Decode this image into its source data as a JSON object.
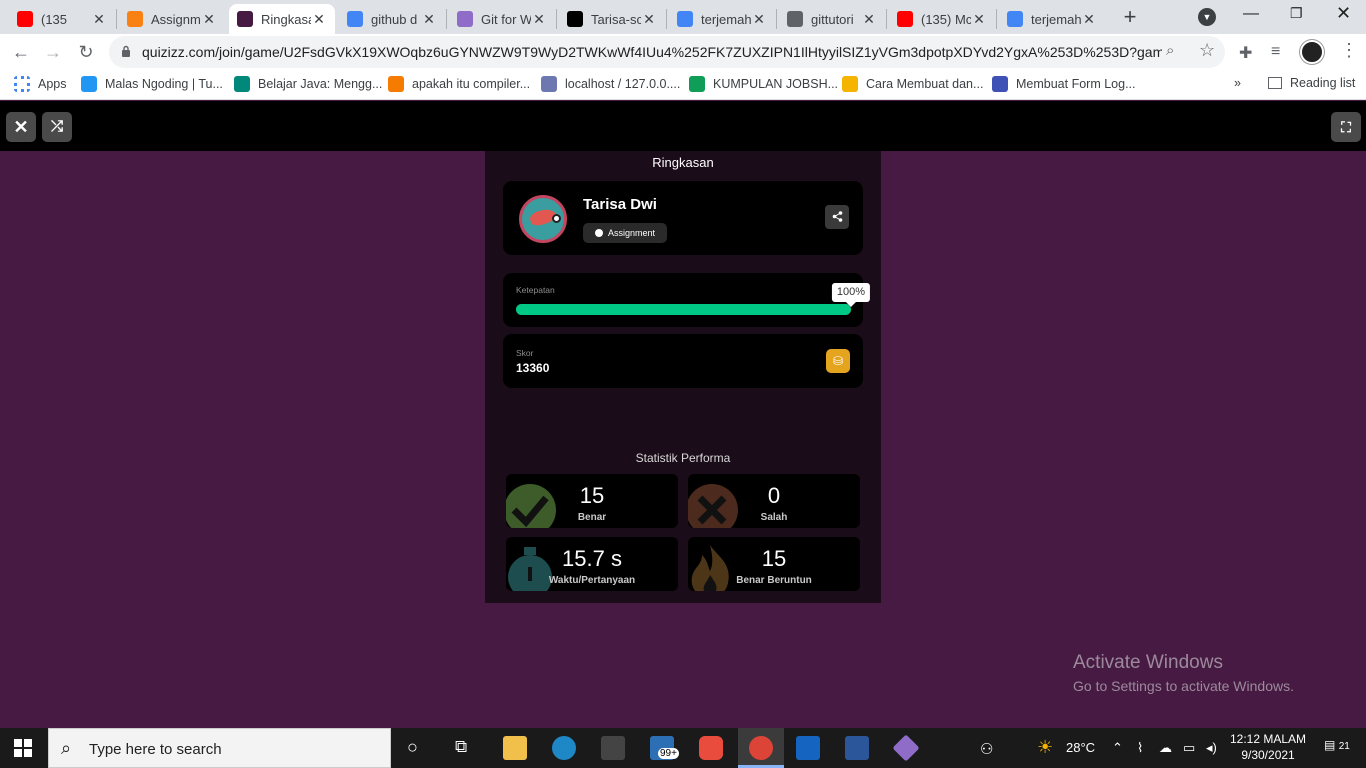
{
  "browser": {
    "tabs": [
      {
        "title": "(135",
        "icon": "youtube-icon",
        "color": "#ff0000"
      },
      {
        "title": "Assignm",
        "icon": "moodle-icon",
        "color": "#f98012"
      },
      {
        "title": "Ringkasa",
        "icon": "quizizz-icon",
        "color": "#461a42"
      },
      {
        "title": "github d",
        "icon": "google-icon",
        "color": "#4285f4"
      },
      {
        "title": "Git for W",
        "icon": "git-icon",
        "color": "#8e6cc7"
      },
      {
        "title": "Tarisa-sc",
        "icon": "github-icon",
        "color": "#000000"
      },
      {
        "title": "terjemah",
        "icon": "google-icon",
        "color": "#4285f4"
      },
      {
        "title": "gittutori",
        "icon": "globe-icon",
        "color": "#5f6368"
      },
      {
        "title": "(135) Mc",
        "icon": "youtube-icon",
        "color": "#ff0000"
      },
      {
        "title": "terjemah",
        "icon": "google-icon",
        "color": "#4285f4"
      }
    ],
    "url": "quizizz.com/join/game/U2FsdGVkX19XWOqbz6uGYNWZW9T9WyD2TWKwWf4IUu4%252FK7ZUXZIPN1IlHtyyilSIZ1yVGm3dpotpXDYvd2YgxA%253D%253D?gameT..."
  },
  "bookmarks": {
    "items": [
      {
        "label": "Apps",
        "color": "#4285f4"
      },
      {
        "label": "Malas Ngoding | Tu...",
        "color": "#2196f3"
      },
      {
        "label": "Belajar Java: Mengg...",
        "color": "#00897b"
      },
      {
        "label": "apakah itu compiler...",
        "color": "#f57c00"
      },
      {
        "label": "localhost / 127.0.0....",
        "color": "#6c78af"
      },
      {
        "label": "KUMPULAN JOBSH...",
        "color": "#0f9d58"
      },
      {
        "label": "Cara Membuat dan...",
        "color": "#f4b400"
      },
      {
        "label": "Membuat Form Log...",
        "color": "#3f51b5"
      }
    ],
    "more": "»",
    "reading_list": "Reading list"
  },
  "summary": {
    "title": "Ringkasan",
    "player_name": "Tarisa Dwi",
    "mode_badge": "Assignment",
    "accuracy_label": "Ketepatan",
    "accuracy_text": "100%",
    "accuracy_value": 1.0,
    "score_label": "Skor",
    "score": "13360",
    "stats_title": "Statistik Performa",
    "stats": [
      {
        "value": "15",
        "caption": "Benar",
        "icon": "check-icon",
        "color": "#3a5a2a"
      },
      {
        "value": "0",
        "caption": "Salah",
        "icon": "cross-icon",
        "color": "#4a2a20"
      },
      {
        "value": "15.7 s",
        "caption": "Waktu/Pertanyaan",
        "icon": "stopwatch-icon",
        "color": "#1e4a4a"
      },
      {
        "value": "15",
        "caption": "Benar Beruntun",
        "icon": "flame-icon",
        "color": "#4a3618"
      }
    ]
  },
  "watermark": {
    "line1": "Activate Windows",
    "line2": "Go to Settings to activate Windows."
  },
  "taskbar": {
    "search_placeholder": "Type here to search",
    "store_badge": "99+",
    "temperature": "28°C",
    "time": "12:12 MALAM",
    "date": "9/30/2021",
    "notification_count": "21"
  }
}
